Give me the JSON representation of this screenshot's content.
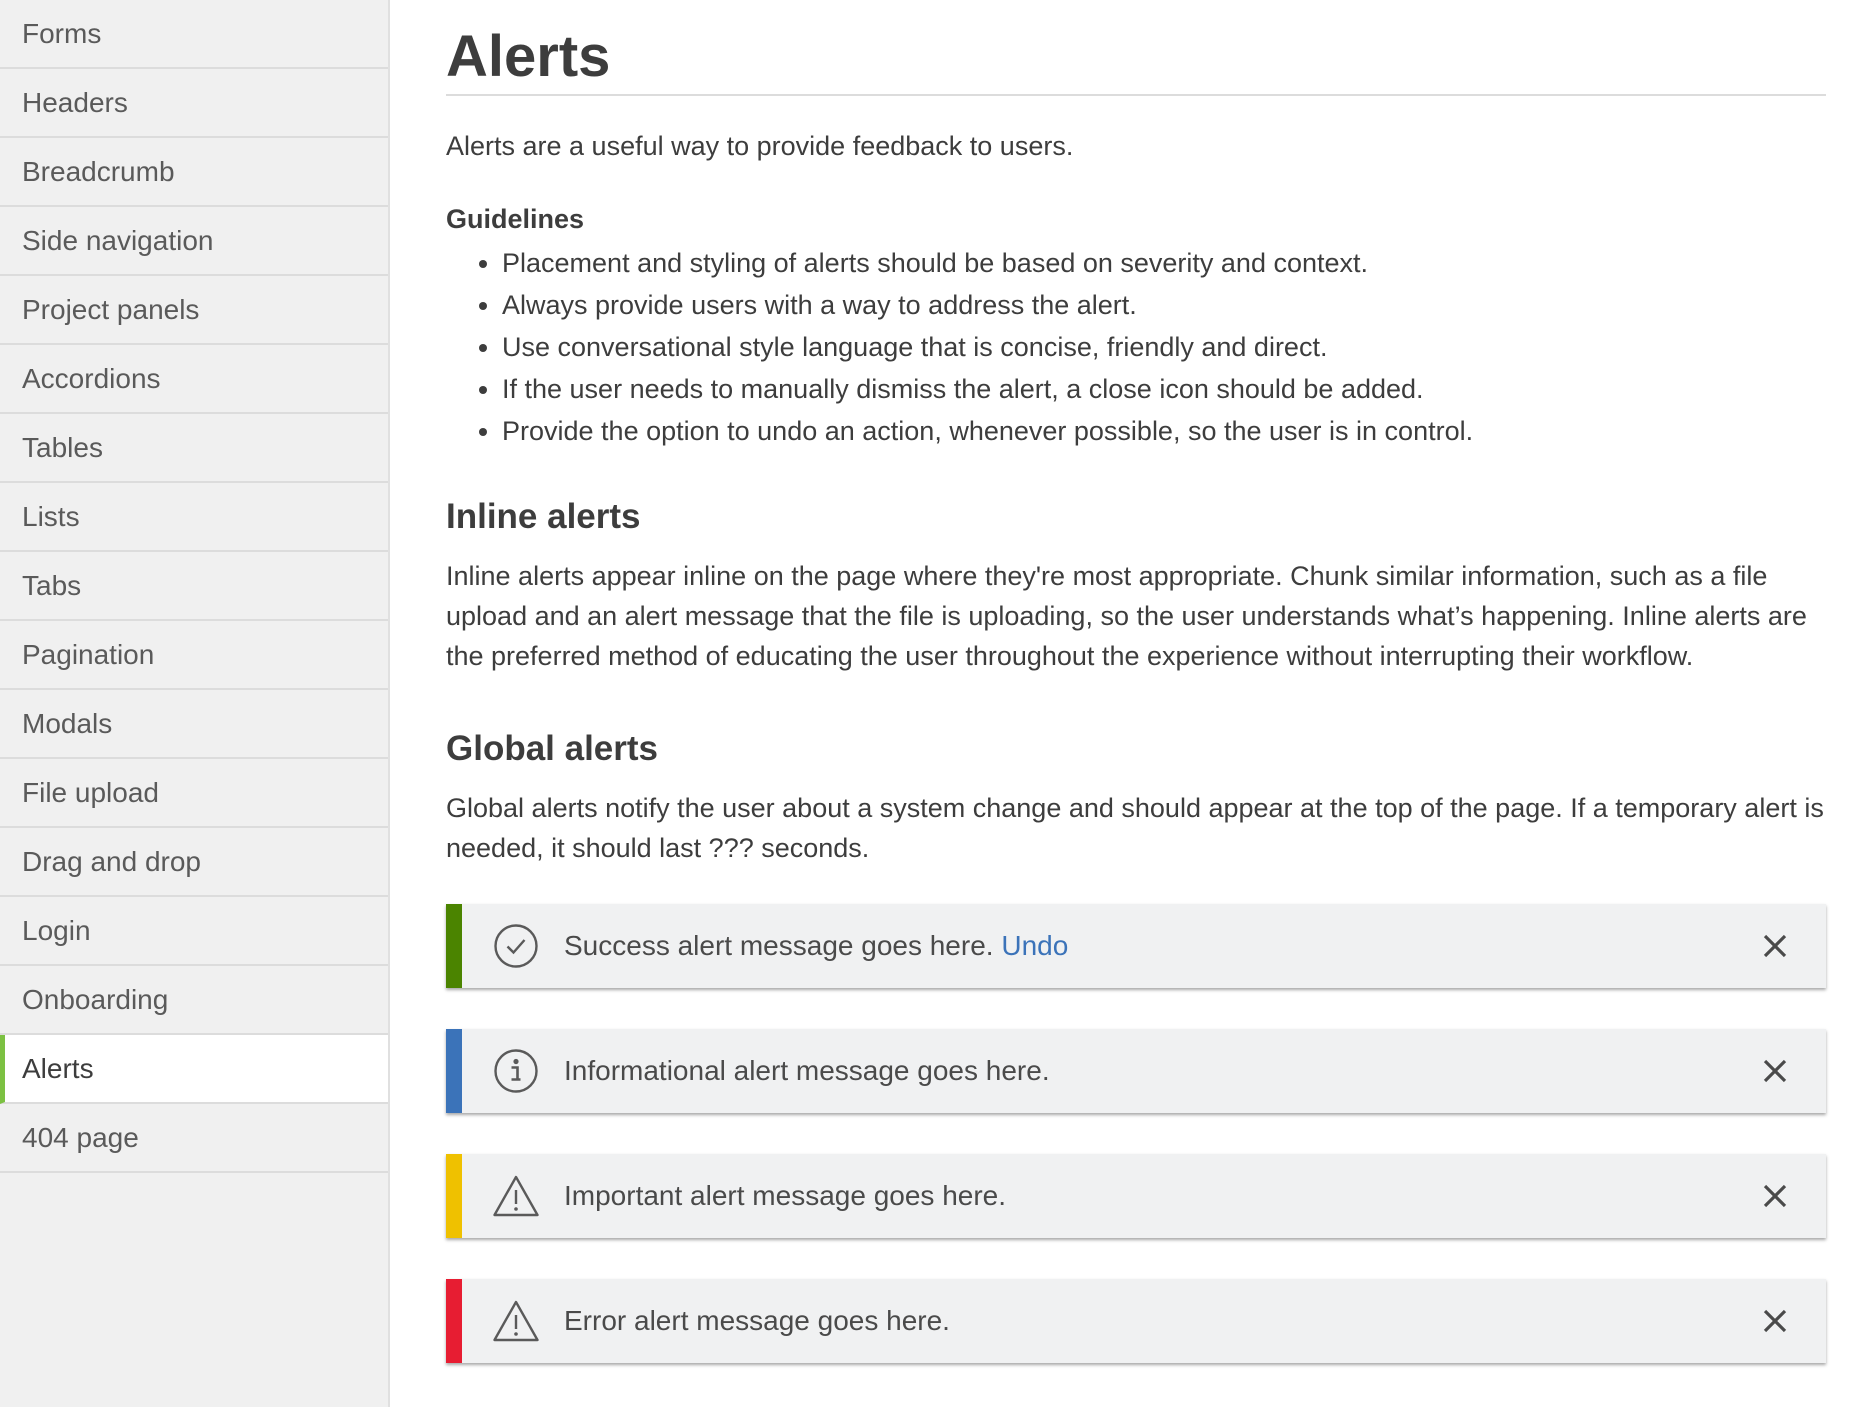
{
  "sidebar": {
    "items": [
      {
        "label": "Forms"
      },
      {
        "label": "Headers"
      },
      {
        "label": "Breadcrumb"
      },
      {
        "label": "Side navigation"
      },
      {
        "label": "Project panels"
      },
      {
        "label": "Accordions"
      },
      {
        "label": "Tables"
      },
      {
        "label": "Lists"
      },
      {
        "label": "Tabs"
      },
      {
        "label": "Pagination"
      },
      {
        "label": "Modals"
      },
      {
        "label": "File upload"
      },
      {
        "label": "Drag and drop"
      },
      {
        "label": "Login"
      },
      {
        "label": "Onboarding"
      },
      {
        "label": "Alerts"
      },
      {
        "label": "404 page"
      }
    ],
    "active_label": "Alerts",
    "active_color": "#7cc142"
  },
  "main": {
    "title": "Alerts",
    "intro": "Alerts are a useful way to provide feedback to users.",
    "guidelines_title": "Guidelines",
    "guidelines": [
      "Placement and styling of alerts should be based on severity and context.",
      "Always provide users with a way to address the alert.",
      "Use conversational style language that is concise, friendly and direct.",
      "If the user needs to manually dismiss the alert, a close icon should be added.",
      "Provide the option to undo an action, whenever possible, so the user is in control."
    ],
    "inline_title": "Inline alerts",
    "inline_text": "Inline alerts appear inline on the page where they're most appropriate. Chunk similar information, such as a file upload and an alert message that the file is uploading, so the user understands what’s happening. Inline alerts are the preferred method of educating the user throughout the experience without interrupting their workflow.",
    "global_title": "Global alerts",
    "global_text": "Global alerts notify the user about a system change and should appear at the top of the page. If a temporary alert is needed, it should last ??? seconds."
  },
  "alerts": [
    {
      "type": "success",
      "message": "Success alert message goes here.",
      "link": "Undo",
      "color": "#4b8400",
      "icon": "check-circle-icon"
    },
    {
      "type": "info",
      "message": "Informational alert message goes here.",
      "color": "#3b73b9",
      "icon": "info-circle-icon"
    },
    {
      "type": "warning",
      "message": "Important alert message goes here.",
      "color": "#efc100",
      "icon": "warning-triangle-icon"
    },
    {
      "type": "error",
      "message": "Error alert message goes here.",
      "color": "#e71d32",
      "icon": "warning-triangle-icon"
    }
  ]
}
